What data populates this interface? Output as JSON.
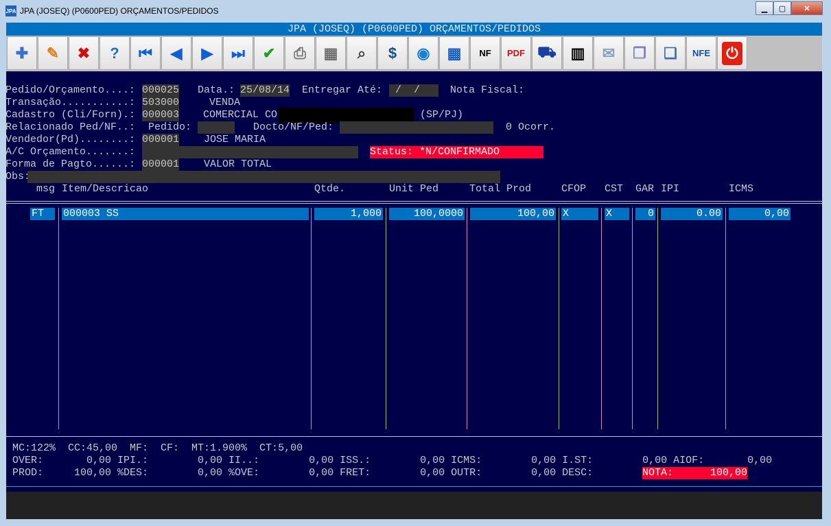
{
  "window": {
    "title": "JPA (JOSEQ) (P0600PED) ORÇAMENTOS/PEDIDOS",
    "app_icon": "JPA"
  },
  "screen_title": "JPA (JOSEQ) (P0600PED) ORÇAMENTOS/PEDIDOS",
  "toolbar": [
    {
      "name": "new-icon",
      "glyph": "✚",
      "color": "#3a6fd0"
    },
    {
      "name": "edit-icon",
      "glyph": "✎",
      "color": "#e08020"
    },
    {
      "name": "delete-icon",
      "glyph": "✖",
      "color": "#d01010"
    },
    {
      "name": "open-folder-icon",
      "glyph": "?",
      "color": "#2070c0"
    },
    {
      "name": "first-record-icon",
      "glyph": "⏮",
      "color": "#1060d0"
    },
    {
      "name": "previous-record-icon",
      "glyph": "◀",
      "color": "#1060d0"
    },
    {
      "name": "next-record-icon",
      "glyph": "▶",
      "color": "#1060d0"
    },
    {
      "name": "last-record-icon",
      "glyph": "⏭",
      "color": "#1060d0"
    },
    {
      "name": "confirm-check-icon",
      "glyph": "✔",
      "color": "#20a020"
    },
    {
      "name": "print-icon",
      "glyph": "⎙",
      "color": "#777"
    },
    {
      "name": "calculator-icon",
      "glyph": "▦",
      "color": "#707070"
    },
    {
      "name": "search-icon",
      "glyph": "⌕",
      "color": "#444"
    },
    {
      "name": "dollar-icon",
      "glyph": "$",
      "color": "#1a4f8a"
    },
    {
      "name": "chat-icon",
      "glyph": "◉",
      "color": "#1a80d0"
    },
    {
      "name": "calendar-grid-icon",
      "glyph": "▦",
      "color": "#1a60c0"
    },
    {
      "name": "nf-icon",
      "glyph": "NF",
      "color": "#000"
    },
    {
      "name": "pdf-icon",
      "glyph": "PDF",
      "color": "#d01010"
    },
    {
      "name": "truck-icon",
      "glyph": "⛟",
      "color": "#1a40a0"
    },
    {
      "name": "barcode-icon",
      "glyph": "▥",
      "color": "#000"
    },
    {
      "name": "mail-icon",
      "glyph": "✉",
      "color": "#8aa0c0"
    },
    {
      "name": "copy-icon",
      "glyph": "❐",
      "color": "#8080c0"
    },
    {
      "name": "windows-icon",
      "glyph": "❏",
      "color": "#4070b0"
    },
    {
      "name": "nfe-sefaz-icon",
      "glyph": "NFE",
      "color": "#1a50a0"
    },
    {
      "name": "power-exit-icon",
      "glyph": "⏻",
      "color": "#fff"
    }
  ],
  "form": {
    "pedido_label": "Pedido/Orçamento....:",
    "pedido": "000025",
    "data_label": "Data.:",
    "data": "25/08/14",
    "entregar_label": "Entregar Até:",
    "entregar": " /  / ",
    "nf_label": "Nota Fiscal:",
    "transacao_label": "Transação...........:",
    "transacao": "503000",
    "transacao_desc": "VENDA",
    "cadastro_label": "Cadastro (Cli/Forn).:",
    "cadastro": "000003",
    "cadastro_desc": "COMERCIAL CO",
    "cadastro_uf": "(SP/PJ)",
    "relacionado_label": "Relacionado Ped/NF..:",
    "pedido2_label": "Pedido:",
    "docto_label": "Docto/NF/Ped:",
    "ocorr": "0 Ocorr.",
    "vendedor_label": "Vendedor(Pd)........:",
    "vendedor": "000001",
    "vendedor_desc": "JOSE MARIA",
    "ac_label": "A/C Orçamento.......:",
    "status": "Status: *N/CONFIRMADO",
    "pagto_label": "Forma de Pagto......:",
    "pagto": "000001",
    "pagto_desc": "VALOR TOTAL",
    "obs_label": "Obs:"
  },
  "table": {
    "headers": {
      "msg": "msg",
      "item": "Item/Descricao",
      "qtde": "Qtde.",
      "unit": "Unit Ped",
      "total": "Total Prod",
      "cfop": "CFOP",
      "cst": "CST",
      "gar": "GAR",
      "ipi": "IPI",
      "icms": "ICMS"
    },
    "rows": [
      {
        "msg": "FT",
        "item": "000003 SS",
        "qtde": "1,000",
        "unit": "100,0000",
        "total": "100,00",
        "cfop": "X",
        "cst": "X",
        "gar": "0",
        "ipi": "0.00",
        "icms": "0,00"
      }
    ]
  },
  "summary": {
    "line1": "MC:122%  CC:45,00  MF:  CF:  MT:1.900%  CT:5,00",
    "line2": "OVER:       0,00 IPI.:        0,00 II..:        0,00 ISS.:        0,00 ICMS:        0,00 I.ST:        0,00 AIOF:       0,00",
    "line3a": "PROD:     100,00 %DES:        0,00 %OVE:        0,00 FRET:        0,00 OUTR:        0,00 DESC:        0,00 ",
    "nota": "NOTA:      100,00"
  }
}
